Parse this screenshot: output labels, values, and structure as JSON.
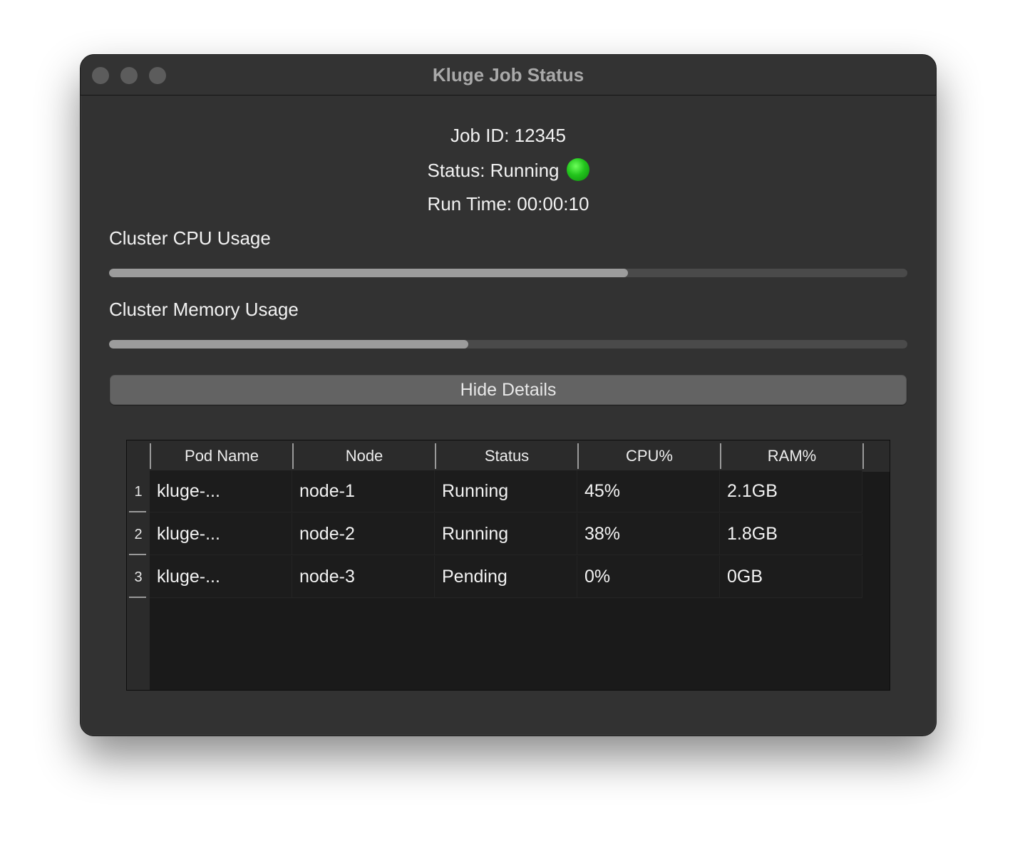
{
  "window": {
    "title": "Kluge Job Status"
  },
  "job": {
    "id_text": "Job ID: 12345",
    "status_text": "Status: Running",
    "status_color": "#22c41c",
    "runtime_text": "Run Time: 00:00:10"
  },
  "cpu": {
    "label": "Cluster CPU Usage",
    "fraction": 0.65
  },
  "memory": {
    "label": "Cluster Memory Usage",
    "fraction": 0.45
  },
  "details_button": {
    "label": "Hide Details"
  },
  "table": {
    "columns": [
      "Pod Name",
      "Node",
      "Status",
      "CPU%",
      "RAM%"
    ],
    "rows": [
      {
        "num": "1",
        "cells": [
          "kluge-...",
          "node-1",
          "Running",
          "45%",
          "2.1GB"
        ]
      },
      {
        "num": "2",
        "cells": [
          "kluge-...",
          "node-2",
          "Running",
          "38%",
          "1.8GB"
        ]
      },
      {
        "num": "3",
        "cells": [
          "kluge-...",
          "node-3",
          "Pending",
          "0%",
          "0GB"
        ]
      }
    ]
  },
  "colors": {
    "window_bg": "#323232",
    "progress_fill": "#9c9c9c",
    "progress_track": "#4a4a4a",
    "table_bg": "#1a1a1a"
  }
}
